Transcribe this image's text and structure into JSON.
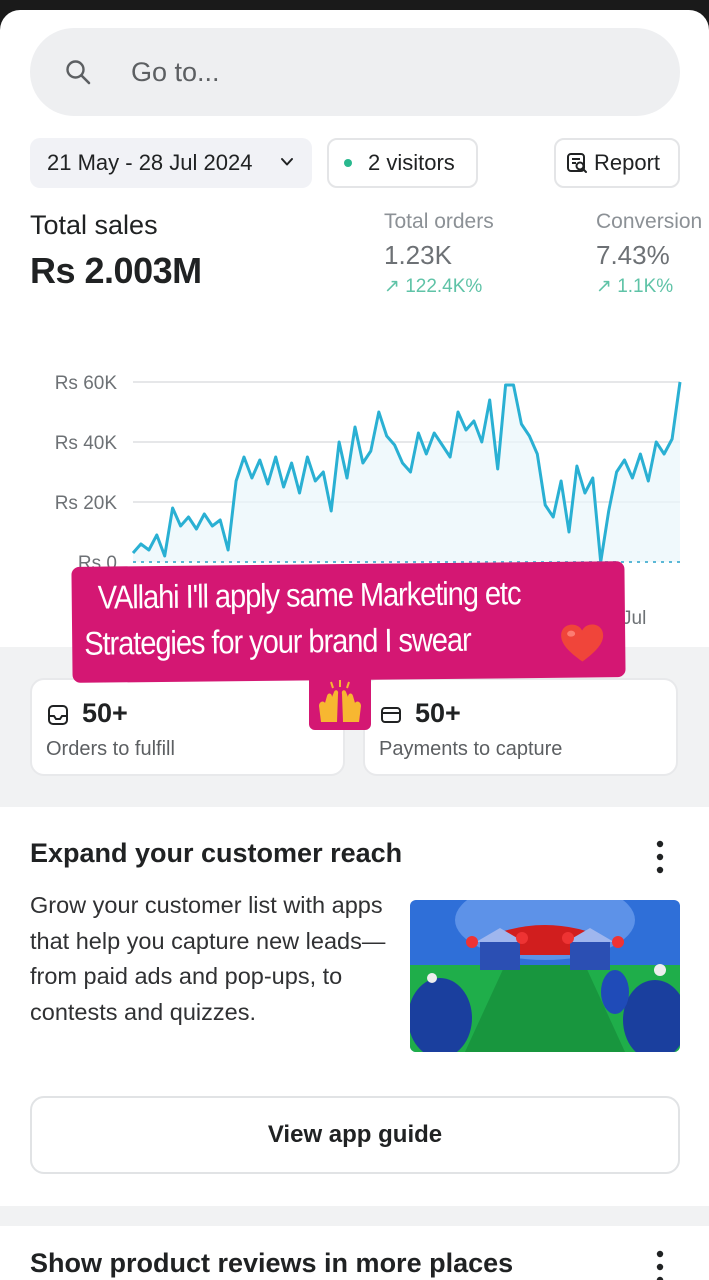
{
  "search": {
    "placeholder": "Go to..."
  },
  "filters": {
    "date_range": "21 May - 28 Jul 2024",
    "visitors": "2 visitors",
    "report_label": "Report"
  },
  "metrics": {
    "total_sales_label": "Total sales",
    "total_sales_value": "Rs 2.003M",
    "total_orders_label": "Total orders",
    "total_orders_value": "1.23K",
    "total_orders_change": "↗ 122.4K%",
    "conversion_label": "Conversion",
    "conversion_value": "7.43%",
    "conversion_change": "↗ 1.1K%"
  },
  "chart_data": {
    "type": "line",
    "ylim": [
      0,
      60000
    ],
    "y_ticks": [
      "Rs 0",
      "Rs 20K",
      "Rs 40K",
      "Rs 60K"
    ],
    "x_ticks": [
      "Jul"
    ],
    "grid": true,
    "series": [
      {
        "color": "#2ab0d3",
        "values": [
          3000,
          6000,
          4000,
          9000,
          2000,
          18000,
          12000,
          15000,
          11000,
          16000,
          12000,
          14000,
          4000,
          27000,
          35000,
          28000,
          34000,
          26000,
          35000,
          25000,
          33000,
          23000,
          35000,
          27000,
          30000,
          17000,
          40000,
          28000,
          45000,
          33000,
          37000,
          50000,
          42000,
          39000,
          33000,
          30000,
          43000,
          36000,
          43000,
          39000,
          35000,
          50000,
          44000,
          47000,
          40000,
          54000,
          31000,
          59000,
          59000,
          46000,
          42000,
          36000,
          19000,
          15000,
          27000,
          10000,
          32000,
          23000,
          28000,
          0,
          17000,
          30000,
          34000,
          28000,
          36000,
          27000,
          40000,
          36000,
          41000,
          60000
        ]
      },
      {
        "style": "dotted",
        "color": "#5bb8d6",
        "values": [
          0,
          0
        ]
      }
    ]
  },
  "summary": {
    "orders_value": "50+",
    "orders_label": "Orders to fulfill",
    "payments_value": "50+",
    "payments_label": "Payments to capture"
  },
  "overlay": {
    "line1": "VAllahi  I'll apply same Marketing etc",
    "line2": "Strategies for your brand I swear",
    "emoji_heart": "❤️",
    "emoji_hands": "🙌"
  },
  "card": {
    "title": "Expand your customer reach",
    "body": "Grow your customer list with apps that help you capture new leads—from paid ads and pop-ups, to contests and quizzes.",
    "button_label": "View app guide"
  },
  "card2": {
    "title": "Show product reviews in more places"
  },
  "icons": {
    "search": "search-icon",
    "chevron": "chevron-down-icon",
    "report": "report-icon",
    "orders": "orders-icon",
    "payments": "payments-icon",
    "more": "more-vertical-icon"
  }
}
